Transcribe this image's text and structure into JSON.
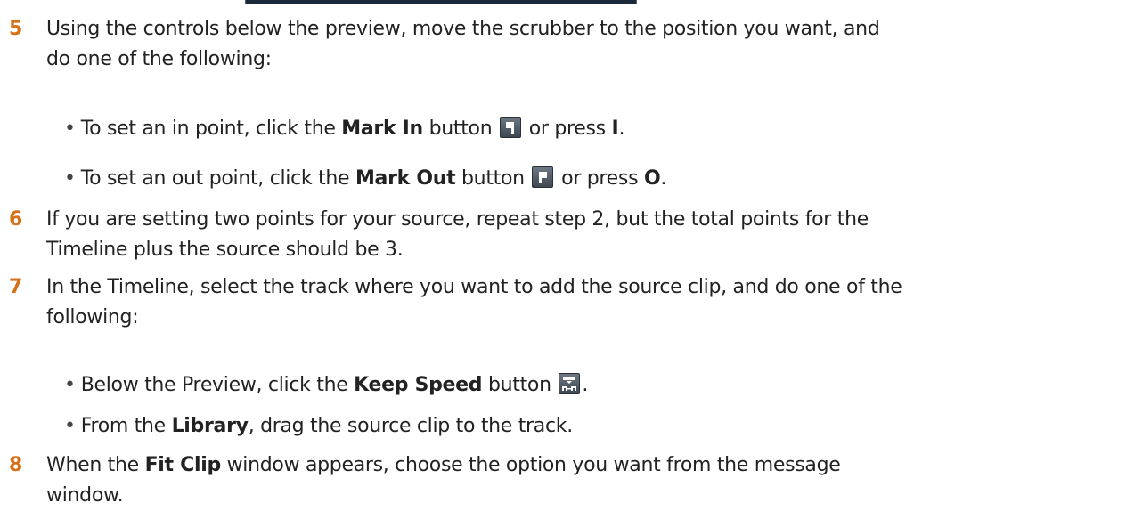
{
  "steps": [
    {
      "num": "5",
      "line1": "Using the controls below the preview, move the scrubber to the position you want, and",
      "line2": "do one of the following:"
    },
    {
      "num": "6",
      "line1": "If you are setting two points for your source, repeat step 2, but the total points for the",
      "line2": "Timeline plus the source should be 3."
    },
    {
      "num": "7",
      "line1": "In the Timeline, select the track where you want to add the source clip, and do one of the",
      "line2": "following:"
    },
    {
      "num": "8",
      "line1_a": "When the ",
      "line1_b": "Fit Clip",
      "line1_c": " window appears, choose the option you want from the message",
      "line2": "window."
    }
  ],
  "bullets": {
    "mark_in": {
      "pre": "To set an in point, click the ",
      "bold": "Mark In",
      "mid": " button ",
      "post": " or press ",
      "key": "I",
      "end": "."
    },
    "mark_out": {
      "pre": "To set an out point, click the ",
      "bold": "Mark Out",
      "mid": " button ",
      "post": " or press ",
      "key": "O",
      "end": "."
    },
    "keep_speed": {
      "pre": "Below the Preview, click the ",
      "bold": "Keep Speed",
      "mid": " button ",
      "end": "."
    },
    "library": {
      "pre": "From the ",
      "bold": "Library",
      "end": ", drag the source clip to the track."
    }
  },
  "bullet_char": "•",
  "icons": {
    "mark_in": "mark-in-icon",
    "mark_out": "mark-out-icon",
    "keep_speed": "keep-speed-icon"
  },
  "colors": {
    "step_number": "#d4721b",
    "text": "#222222",
    "icon_bg": "#4a5560"
  }
}
